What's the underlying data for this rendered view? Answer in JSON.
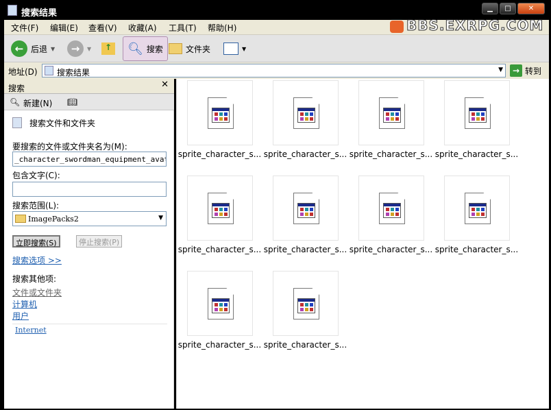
{
  "window": {
    "title": "搜索结果",
    "watermark": "BBS.EXRPG.COM"
  },
  "menu": [
    "文件(F)",
    "编辑(E)",
    "查看(V)",
    "收藏(A)",
    "工具(T)",
    "帮助(H)"
  ],
  "toolbar": {
    "back": "后退",
    "search": "搜索",
    "folders": "文件夹"
  },
  "address": {
    "label": "地址(D)",
    "value": "搜索结果",
    "go": "转到"
  },
  "search_pane": {
    "title": "搜索",
    "new": "新建(N)",
    "heading": "搜索文件和文件夹",
    "name_label": "要搜索的文件或文件夹名为(M):",
    "name_value": "_character_swordman_equipment_avatar_",
    "text_label": "包含文字(C):",
    "text_value": "",
    "scope_label": "搜索范围(L):",
    "scope_value": "ImagePacks2",
    "search_now": "立即搜索(S)",
    "stop": "停止搜索(P)",
    "options": "搜索选项 >>",
    "other_label": "搜索其他项:",
    "other_links": [
      "文件或文件夹",
      "计算机",
      "用户"
    ],
    "internet": "Internet"
  },
  "results": [
    "sprite_character_s...",
    "sprite_character_s...",
    "sprite_character_s...",
    "sprite_character_s...",
    "sprite_character_s...",
    "sprite_character_s...",
    "sprite_character_s...",
    "sprite_character_s...",
    "sprite_character_s...",
    "sprite_character_s..."
  ]
}
